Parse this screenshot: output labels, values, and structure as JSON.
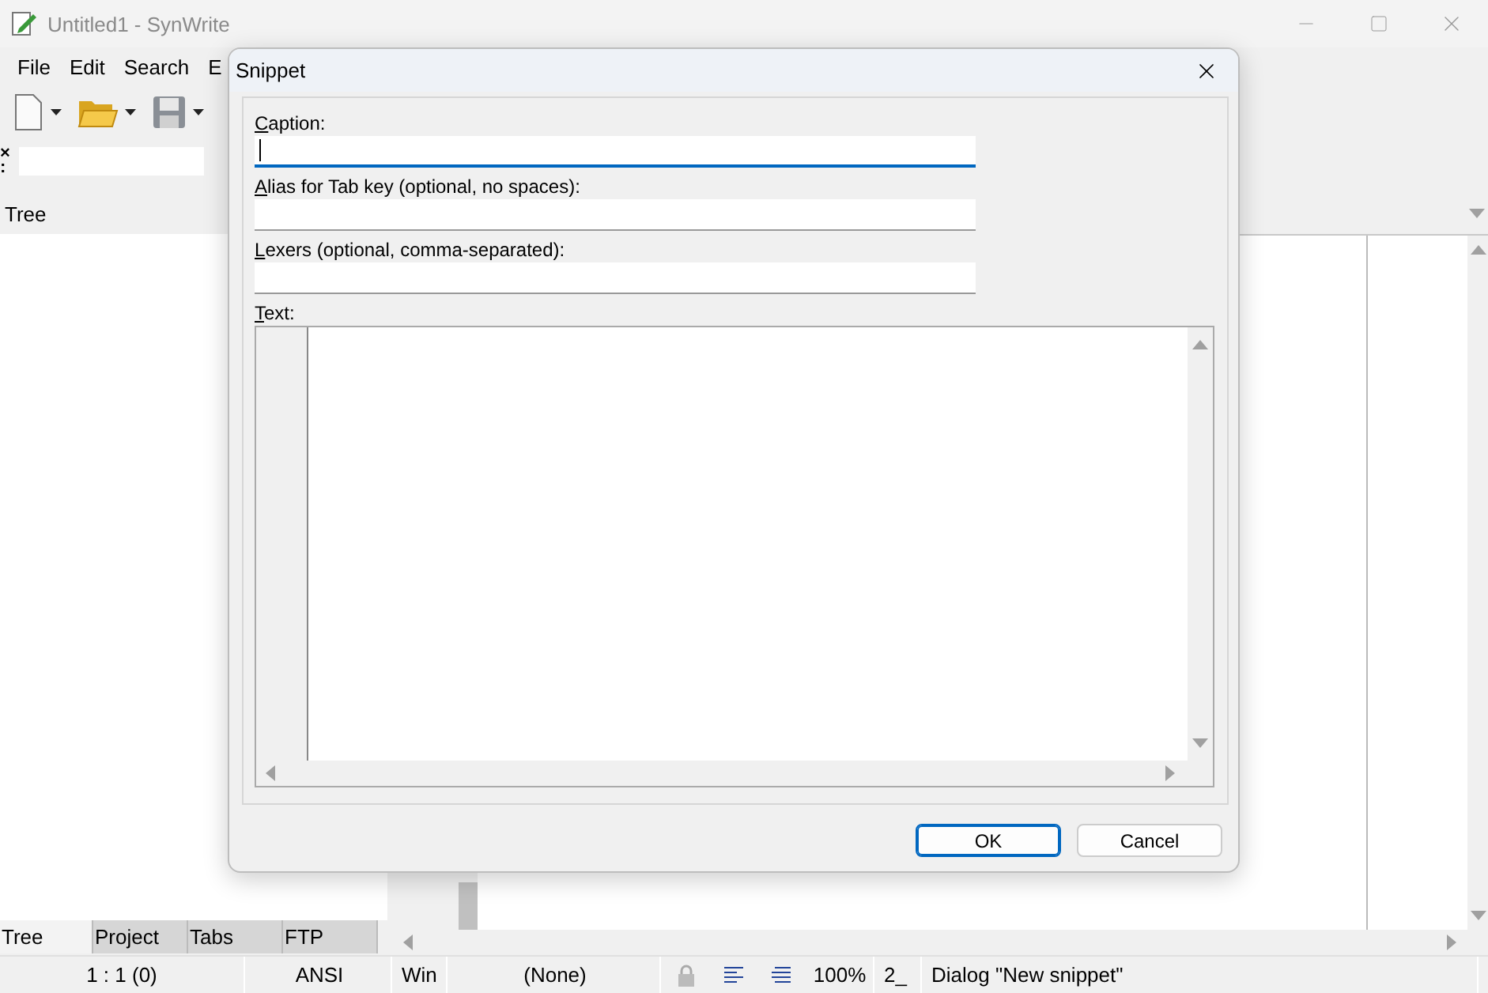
{
  "window": {
    "title": "Untitled1 - SynWrite"
  },
  "menu": [
    {
      "label": "File"
    },
    {
      "label": "Edit"
    },
    {
      "label": "Search"
    },
    {
      "label": "E"
    }
  ],
  "filter": {
    "close_glyph": "×",
    "label": ":"
  },
  "left_panel": {
    "header": "Tree",
    "tabs": [
      {
        "label": "Tree",
        "selected": true
      },
      {
        "label": "Project",
        "selected": false
      },
      {
        "label": "Tabs",
        "selected": false
      },
      {
        "label": "FTP",
        "selected": false
      }
    ]
  },
  "status_bar": {
    "position": "1 : 1 (0)",
    "encoding": "ANSI",
    "line_ends": "Win",
    "lexer": "(None)",
    "zoom": "100%",
    "mode": "2_",
    "message": "Dialog \"New snippet\""
  },
  "dialog": {
    "title": "Snippet",
    "fields": [
      {
        "label": "Caption:",
        "focused": true
      },
      {
        "label": "Alias for Tab key (optional, no spaces):",
        "focused": false
      },
      {
        "label": "Lexers (optional, comma-separated):",
        "focused": false
      }
    ],
    "text_label": "Text:",
    "buttons": [
      {
        "label": "OK",
        "default": true
      },
      {
        "label": "Cancel",
        "default": false
      }
    ]
  }
}
